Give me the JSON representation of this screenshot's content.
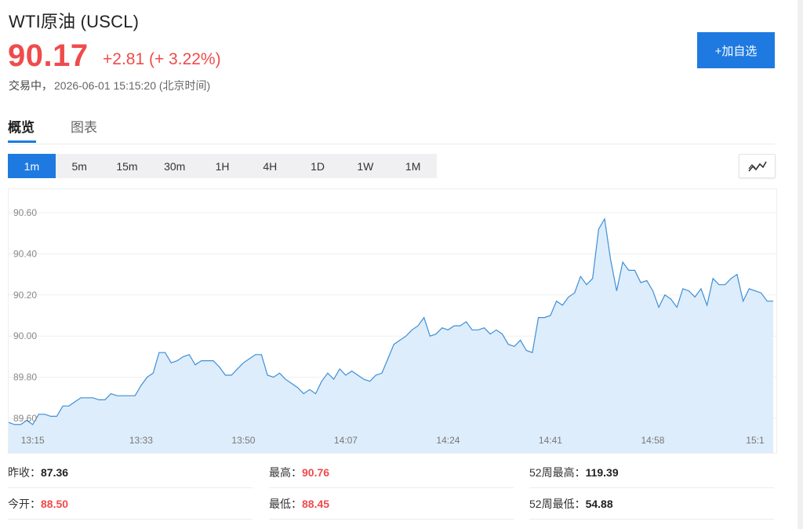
{
  "header": {
    "title": "WTI原油 (USCL)",
    "price": "90.17",
    "change": "+2.81 (+ 3.22%)",
    "status": "交易中，",
    "timestamp": "2026-06-01 15:15:20 (北京时间)",
    "add_button": "+加自选"
  },
  "tabs": [
    {
      "label": "概览",
      "active": true
    },
    {
      "label": "图表",
      "active": false
    }
  ],
  "intervals": [
    {
      "label": "1m",
      "active": true
    },
    {
      "label": "5m"
    },
    {
      "label": "15m"
    },
    {
      "label": "30m"
    },
    {
      "label": "1H"
    },
    {
      "label": "4H"
    },
    {
      "label": "1D"
    },
    {
      "label": "1W"
    },
    {
      "label": "1M"
    }
  ],
  "stats": [
    {
      "label": "昨收：",
      "value": "87.36",
      "color": "normal"
    },
    {
      "label": "最高：",
      "value": "90.76",
      "color": "red"
    },
    {
      "label": "52周最高：",
      "value": "119.39",
      "color": "normal"
    },
    {
      "label": "今开：",
      "value": "88.50",
      "color": "red"
    },
    {
      "label": "最低：",
      "value": "88.45",
      "color": "red"
    },
    {
      "label": "52周最低：",
      "value": "54.88",
      "color": "normal"
    }
  ],
  "colors": {
    "up": "#f04b4b",
    "accent": "#1e7ae0",
    "line": "#3d8fd8",
    "area": "#deedfb"
  },
  "chart_data": {
    "type": "area",
    "y_ticks": [
      "89.60",
      "89.80",
      "90.00",
      "90.20",
      "90.40",
      "90.60"
    ],
    "ylim": [
      89.5,
      90.7
    ],
    "x_ticks": [
      "13:15",
      "13:33",
      "13:50",
      "14:07",
      "14:24",
      "14:41",
      "14:58",
      "15:1"
    ],
    "x_tick_index": [
      4,
      22,
      39,
      56,
      73,
      90,
      107,
      124
    ],
    "grid": true,
    "values": [
      89.58,
      89.57,
      89.57,
      89.59,
      89.57,
      89.62,
      89.62,
      89.61,
      89.61,
      89.66,
      89.66,
      89.68,
      89.7,
      89.7,
      89.7,
      89.69,
      89.69,
      89.72,
      89.71,
      89.71,
      89.71,
      89.71,
      89.76,
      89.8,
      89.82,
      89.92,
      89.92,
      89.87,
      89.88,
      89.9,
      89.91,
      89.86,
      89.88,
      89.88,
      89.88,
      89.85,
      89.81,
      89.81,
      89.84,
      89.87,
      89.89,
      89.91,
      89.91,
      89.81,
      89.8,
      89.82,
      89.79,
      89.77,
      89.75,
      89.72,
      89.74,
      89.72,
      89.78,
      89.82,
      89.79,
      89.84,
      89.81,
      89.83,
      89.81,
      89.79,
      89.78,
      89.81,
      89.82,
      89.89,
      89.96,
      89.98,
      90.0,
      90.03,
      90.05,
      90.09,
      90.0,
      90.01,
      90.04,
      90.03,
      90.05,
      90.05,
      90.07,
      90.03,
      90.03,
      90.04,
      90.01,
      90.03,
      90.01,
      89.96,
      89.95,
      89.98,
      89.93,
      89.92,
      90.09,
      90.09,
      90.1,
      90.17,
      90.15,
      90.19,
      90.21,
      90.29,
      90.25,
      90.28,
      90.52,
      90.57,
      90.37,
      90.22,
      90.36,
      90.32,
      90.32,
      90.26,
      90.27,
      90.22,
      90.14,
      90.2,
      90.18,
      90.14,
      90.23,
      90.22,
      90.19,
      90.23,
      90.15,
      90.28,
      90.25,
      90.25,
      90.28,
      90.3,
      90.17,
      90.23,
      90.22,
      90.21,
      90.17,
      90.17
    ]
  }
}
